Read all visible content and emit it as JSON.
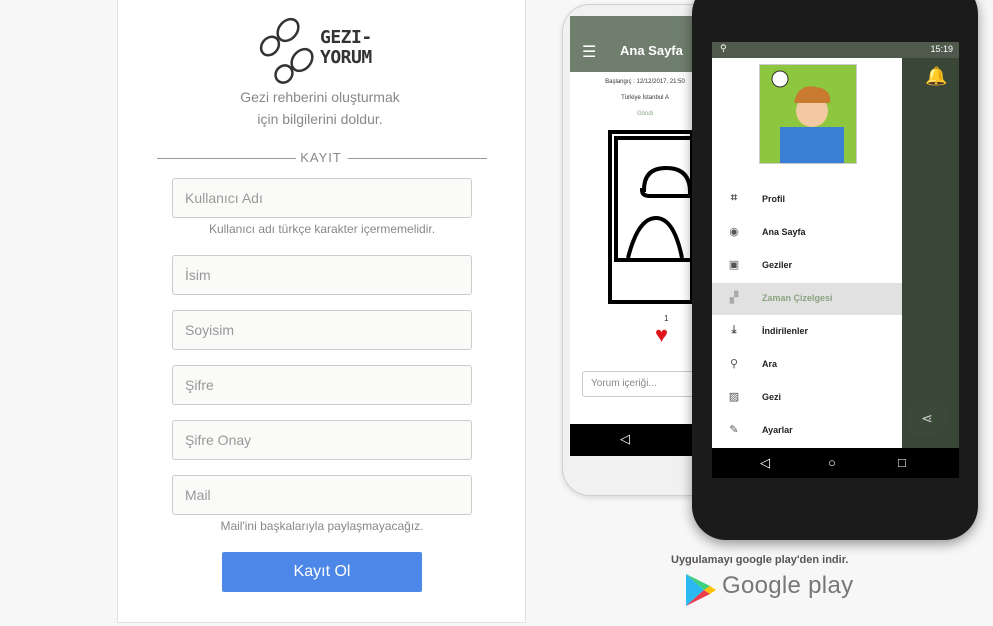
{
  "logo": {
    "line1": "GEZI-",
    "line2": "YORUM"
  },
  "subtitle": {
    "line1": "Gezi rehberini oluşturmak",
    "line2": "için bilgilerini doldur."
  },
  "section_label": "KAYIT",
  "fields": {
    "username": {
      "placeholder": "Kullanıcı Adı",
      "hint": "Kullanıcı adı türkçe karakter içermemelidir."
    },
    "name": {
      "placeholder": "İsim"
    },
    "surname": {
      "placeholder": "Soyisim"
    },
    "password": {
      "placeholder": "Şifre"
    },
    "password_confirm": {
      "placeholder": "Şifre Onay"
    },
    "mail": {
      "placeholder": "Mail",
      "hint": "Mail'ini başkalarıyla paylaşmayacağız."
    }
  },
  "submit_label": "Kayıt Ol",
  "back_phone": {
    "title": "Ana Sayfa",
    "start_line": "Başlangıç : 12/12/2017, 21:50",
    "location": "Türkiye İstanbul A",
    "sent_label": "Göndi",
    "like_count": "1",
    "comment_placeholder": "Yorum içeriği..."
  },
  "front_phone": {
    "time": "15:19",
    "menu": [
      "Profil",
      "Ana Sayfa",
      "Geziler",
      "Zaman Çizelgesi",
      "İndirilenler",
      "Ara",
      "Gezi",
      "Ayarlar"
    ],
    "active_index": 3
  },
  "download_text": "Uygulamayı google play'den indir.",
  "google_play_text": "Google play",
  "colors": {
    "primary": "#4d87e8",
    "app_bar": "#6f7e6d"
  }
}
